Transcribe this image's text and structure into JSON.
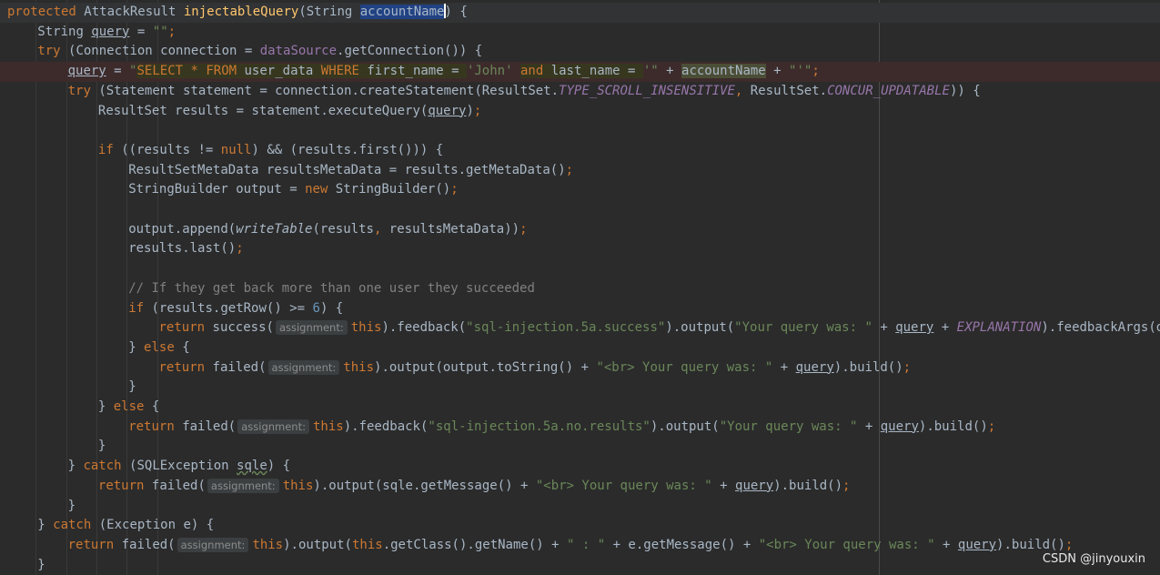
{
  "editor": {
    "colors": {
      "background": "#2b2b2b",
      "keyword": "#cc7832",
      "function": "#ffc66d",
      "string": "#6a8759",
      "comment": "#808080",
      "number": "#6897bb",
      "constant": "#9876aa",
      "default": "#a9b7c6",
      "selection": "#214283"
    },
    "lines": [
      {
        "indent": 0,
        "tokens": [
          {
            "t": "protected ",
            "s": "kw"
          },
          {
            "t": "AttackResult "
          },
          {
            "t": "injectableQuery",
            "s": "fn"
          },
          {
            "t": "(String "
          },
          {
            "t": "accountName",
            "s": "sel"
          },
          {
            "t": "",
            "s": "caret"
          },
          {
            "t": ") {"
          }
        ]
      },
      {
        "indent": 1,
        "tokens": [
          {
            "t": "String "
          },
          {
            "t": "query",
            "s": "under"
          },
          {
            "t": " = "
          },
          {
            "t": "\"\"",
            "s": "str"
          },
          {
            "t": ";",
            "s": "kw"
          }
        ]
      },
      {
        "indent": 1,
        "tokens": [
          {
            "t": "try ",
            "s": "kw"
          },
          {
            "t": "(Connection connection = "
          },
          {
            "t": "dataSource",
            "s": "field"
          },
          {
            "t": ".getConnection()) {"
          }
        ]
      },
      {
        "indent": 2,
        "tokens": [
          {
            "t": "query",
            "s": "under"
          },
          {
            "t": " = "
          },
          {
            "t": "\"",
            "s": "str"
          },
          {
            "t": "SELECT * FROM ",
            "s": "sqlkw"
          },
          {
            "t": "user_data ",
            "s": "sql"
          },
          {
            "t": "WHERE ",
            "s": "sqlkw"
          },
          {
            "t": "first_name = ",
            "s": "sql"
          },
          {
            "t": "'John' ",
            "s": "str"
          },
          {
            "t": "and ",
            "s": "sqlkw"
          },
          {
            "t": "last_name = ",
            "s": "sql"
          },
          {
            "t": "'",
            "s": "str"
          },
          {
            "t": "\"",
            "s": "str"
          },
          {
            "t": " + "
          },
          {
            "t": "accountName",
            "s": "hl"
          },
          {
            "t": " + "
          },
          {
            "t": "\"'\"",
            "s": "str"
          },
          {
            "t": ";",
            "s": "kw"
          }
        ]
      },
      {
        "indent": 2,
        "tokens": [
          {
            "t": "try ",
            "s": "kw"
          },
          {
            "t": "(Statement statement = connection.createStatement(ResultSet."
          },
          {
            "t": "TYPE_SCROLL_INSENSITIVE",
            "s": "const"
          },
          {
            "t": ", ",
            "s": "kw"
          },
          {
            "t": "ResultSet."
          },
          {
            "t": "CONCUR_UPDATABLE",
            "s": "const"
          },
          {
            "t": ")) {"
          }
        ]
      },
      {
        "indent": 3,
        "tokens": [
          {
            "t": "ResultSet results = statement.executeQuery("
          },
          {
            "t": "query",
            "s": "under"
          },
          {
            "t": ")"
          },
          {
            "t": ";",
            "s": "kw"
          }
        ]
      },
      {
        "indent": 0,
        "tokens": []
      },
      {
        "indent": 3,
        "tokens": [
          {
            "t": "if ",
            "s": "kw"
          },
          {
            "t": "((results != "
          },
          {
            "t": "null",
            "s": "kw"
          },
          {
            "t": ") && (results.first())) {"
          }
        ]
      },
      {
        "indent": 4,
        "tokens": [
          {
            "t": "ResultSetMetaData resultsMetaData = results.getMetaData()"
          },
          {
            "t": ";",
            "s": "kw"
          }
        ]
      },
      {
        "indent": 4,
        "tokens": [
          {
            "t": "StringBuilder output = "
          },
          {
            "t": "new ",
            "s": "kw"
          },
          {
            "t": "StringBuilder()"
          },
          {
            "t": ";",
            "s": "kw"
          }
        ]
      },
      {
        "indent": 0,
        "tokens": []
      },
      {
        "indent": 4,
        "tokens": [
          {
            "t": "output.append("
          },
          {
            "t": "writeTable",
            "s": "ital"
          },
          {
            "t": "(results"
          },
          {
            "t": ", ",
            "s": "kw"
          },
          {
            "t": "resultsMetaData))"
          },
          {
            "t": ";",
            "s": "kw"
          }
        ]
      },
      {
        "indent": 4,
        "tokens": [
          {
            "t": "results.last()"
          },
          {
            "t": ";",
            "s": "kw"
          }
        ]
      },
      {
        "indent": 0,
        "tokens": []
      },
      {
        "indent": 4,
        "tokens": [
          {
            "t": "// If they get back more than one user they succeeded",
            "s": "cm"
          }
        ]
      },
      {
        "indent": 4,
        "tokens": [
          {
            "t": "if ",
            "s": "kw"
          },
          {
            "t": "(results.getRow() >= "
          },
          {
            "t": "6",
            "s": "num"
          },
          {
            "t": ") {"
          }
        ]
      },
      {
        "indent": 5,
        "tokens": [
          {
            "t": "return ",
            "s": "kw"
          },
          {
            "t": "success("
          },
          {
            "t": "assignment:",
            "s": "hint"
          },
          {
            "t": "this",
            "s": "kw"
          },
          {
            "t": ").feedback("
          },
          {
            "t": "\"sql-injection.5a.success\"",
            "s": "str"
          },
          {
            "t": ").output("
          },
          {
            "t": "\"Your query was: \"",
            "s": "str"
          },
          {
            "t": " + "
          },
          {
            "t": "query",
            "s": "under"
          },
          {
            "t": " + "
          },
          {
            "t": "EXPLANATION",
            "s": "const"
          },
          {
            "t": ").feedbackArgs(out"
          }
        ]
      },
      {
        "indent": 4,
        "tokens": [
          {
            "t": "} "
          },
          {
            "t": "else ",
            "s": "kw"
          },
          {
            "t": "{"
          }
        ]
      },
      {
        "indent": 5,
        "tokens": [
          {
            "t": "return ",
            "s": "kw"
          },
          {
            "t": "failed("
          },
          {
            "t": "assignment:",
            "s": "hint"
          },
          {
            "t": "this",
            "s": "kw"
          },
          {
            "t": ").output(output.toString() + "
          },
          {
            "t": "\"<br> Your query was: \"",
            "s": "str"
          },
          {
            "t": " + "
          },
          {
            "t": "query",
            "s": "under"
          },
          {
            "t": ").build()"
          },
          {
            "t": ";",
            "s": "kw"
          }
        ]
      },
      {
        "indent": 4,
        "tokens": [
          {
            "t": "}"
          }
        ]
      },
      {
        "indent": 3,
        "tokens": [
          {
            "t": "} "
          },
          {
            "t": "else ",
            "s": "kw"
          },
          {
            "t": "{"
          }
        ]
      },
      {
        "indent": 4,
        "tokens": [
          {
            "t": "return ",
            "s": "kw"
          },
          {
            "t": "failed("
          },
          {
            "t": "assignment:",
            "s": "hint"
          },
          {
            "t": "this",
            "s": "kw"
          },
          {
            "t": ").feedback("
          },
          {
            "t": "\"sql-injection.5a.no.results\"",
            "s": "str"
          },
          {
            "t": ").output("
          },
          {
            "t": "\"Your query was: \"",
            "s": "str"
          },
          {
            "t": " + "
          },
          {
            "t": "query",
            "s": "under"
          },
          {
            "t": ").build()"
          },
          {
            "t": ";",
            "s": "kw"
          }
        ]
      },
      {
        "indent": 3,
        "tokens": [
          {
            "t": "}"
          }
        ]
      },
      {
        "indent": 2,
        "tokens": [
          {
            "t": "} "
          },
          {
            "t": "catch ",
            "s": "kw"
          },
          {
            "t": "(SQLException "
          },
          {
            "t": "sqle",
            "s": "wavy"
          },
          {
            "t": ") {"
          }
        ]
      },
      {
        "indent": 3,
        "tokens": [
          {
            "t": "return ",
            "s": "kw"
          },
          {
            "t": "failed("
          },
          {
            "t": "assignment:",
            "s": "hint"
          },
          {
            "t": "this",
            "s": "kw"
          },
          {
            "t": ").output(sqle.getMessage() + "
          },
          {
            "t": "\"<br> Your query was: \"",
            "s": "str"
          },
          {
            "t": " + "
          },
          {
            "t": "query",
            "s": "under"
          },
          {
            "t": ").build()"
          },
          {
            "t": ";",
            "s": "kw"
          }
        ]
      },
      {
        "indent": 2,
        "tokens": [
          {
            "t": "}"
          }
        ]
      },
      {
        "indent": 1,
        "tokens": [
          {
            "t": "} "
          },
          {
            "t": "catch ",
            "s": "kw"
          },
          {
            "t": "(Exception e) {"
          }
        ]
      },
      {
        "indent": 2,
        "tokens": [
          {
            "t": "return ",
            "s": "kw"
          },
          {
            "t": "failed("
          },
          {
            "t": "assignment:",
            "s": "hint"
          },
          {
            "t": "this",
            "s": "kw"
          },
          {
            "t": ").output("
          },
          {
            "t": "this",
            "s": "kw"
          },
          {
            "t": ".getClass().getName() + "
          },
          {
            "t": "\" : \"",
            "s": "str"
          },
          {
            "t": " + e.getMessage() + "
          },
          {
            "t": "\"<br> Your query was: \"",
            "s": "str"
          },
          {
            "t": " + "
          },
          {
            "t": "query",
            "s": "under"
          },
          {
            "t": ").build()"
          },
          {
            "t": ";",
            "s": "kw"
          }
        ]
      },
      {
        "indent": 1,
        "tokens": [
          {
            "t": "}"
          }
        ]
      }
    ]
  },
  "watermark": {
    "text": "CSDN @jinyouxin"
  }
}
